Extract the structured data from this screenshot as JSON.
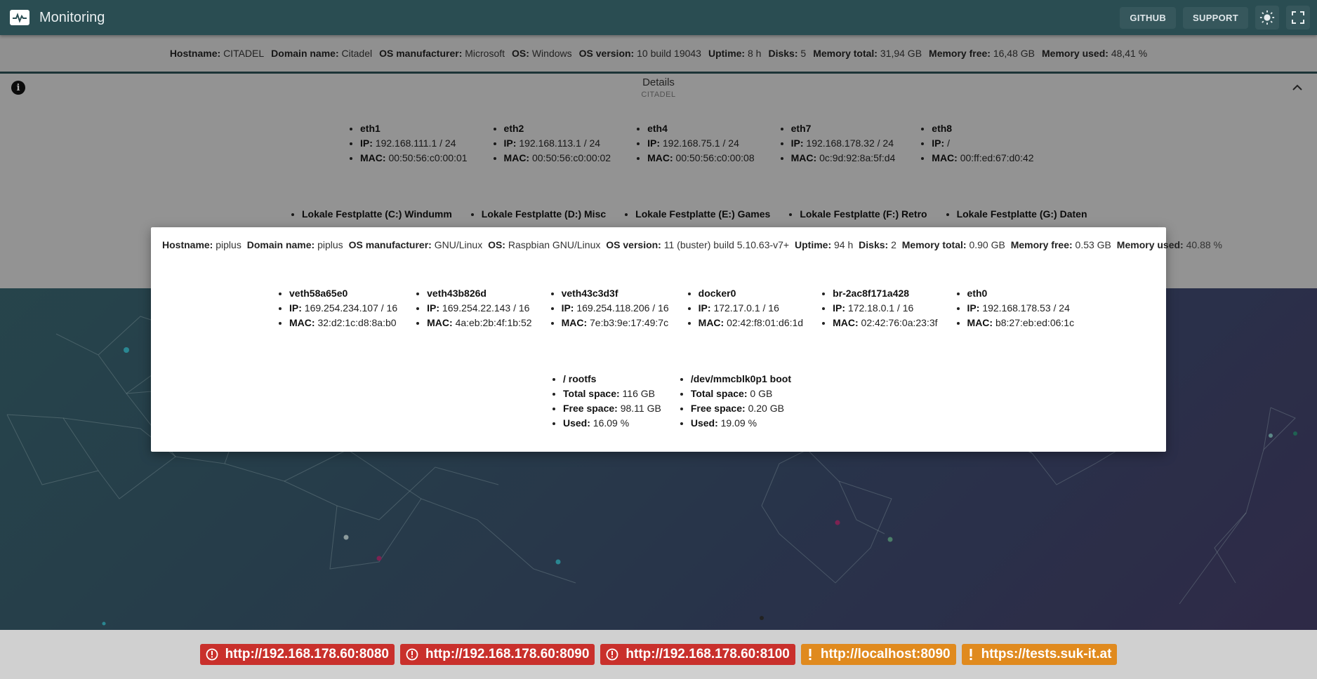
{
  "app": {
    "title": "Monitoring"
  },
  "toolbar": {
    "github_label": "GITHUB",
    "support_label": "SUPPORT"
  },
  "host_summary": [
    {
      "key": "Hostname:",
      "value": "CITADEL"
    },
    {
      "key": "Domain name:",
      "value": "Citadel"
    },
    {
      "key": "OS manufacturer:",
      "value": "Microsoft"
    },
    {
      "key": "OS:",
      "value": "Windows"
    },
    {
      "key": "OS version:",
      "value": "10 build 19043"
    },
    {
      "key": "Uptime:",
      "value": "8 h"
    },
    {
      "key": "Disks:",
      "value": "5"
    },
    {
      "key": "Memory total:",
      "value": "31,94 GB"
    },
    {
      "key": "Memory free:",
      "value": "16,48 GB"
    },
    {
      "key": "Memory used:",
      "value": "48,41 %"
    }
  ],
  "details": {
    "title": "Details",
    "subtitle": "CITADEL",
    "interfaces": [
      {
        "name": "eth1",
        "ip_label": "IP:",
        "ip": "192.168.111.1 / 24",
        "mac_label": "MAC:",
        "mac": "00:50:56:c0:00:01"
      },
      {
        "name": "eth2",
        "ip_label": "IP:",
        "ip": "192.168.113.1 / 24",
        "mac_label": "MAC:",
        "mac": "00:50:56:c0:00:02"
      },
      {
        "name": "eth4",
        "ip_label": "IP:",
        "ip": "192.168.75.1 / 24",
        "mac_label": "MAC:",
        "mac": "00:50:56:c0:00:08"
      },
      {
        "name": "eth7",
        "ip_label": "IP:",
        "ip": "192.168.178.32 / 24",
        "mac_label": "MAC:",
        "mac": "0c:9d:92:8a:5f:d4"
      },
      {
        "name": "eth8",
        "ip_label": "IP:",
        "ip": "/",
        "mac_label": "MAC:",
        "mac": "00:ff:ed:67:d0:42"
      }
    ],
    "disks": [
      {
        "name": "Lokale Festplatte (C:) Windumm"
      },
      {
        "name": "Lokale Festplatte (D:) Misc"
      },
      {
        "name": "Lokale Festplatte (E:) Games"
      },
      {
        "name": "Lokale Festplatte (F:) Retro"
      },
      {
        "name": "Lokale Festplatte (G:) Daten"
      }
    ]
  },
  "modal": {
    "summary": [
      {
        "key": "Hostname:",
        "value": "piplus"
      },
      {
        "key": "Domain name:",
        "value": "piplus"
      },
      {
        "key": "OS manufacturer:",
        "value": "GNU/Linux"
      },
      {
        "key": "OS:",
        "value": "Raspbian GNU/Linux"
      },
      {
        "key": "OS version:",
        "value": "11 (buster) build 5.10.63-v7+"
      },
      {
        "key": "Uptime:",
        "value": "94 h"
      },
      {
        "key": "Disks:",
        "value": "2"
      },
      {
        "key": "Memory total:",
        "value": "0.90 GB"
      },
      {
        "key": "Memory free:",
        "value": "0.53 GB"
      },
      {
        "key": "Memory used:",
        "value": "40.88 %"
      }
    ],
    "interfaces": [
      {
        "name": "veth58a65e0",
        "ip_label": "IP:",
        "ip": "169.254.234.107 / 16",
        "mac_label": "MAC:",
        "mac": "32:d2:1c:d8:8a:b0"
      },
      {
        "name": "veth43b826d",
        "ip_label": "IP:",
        "ip": "169.254.22.143 / 16",
        "mac_label": "MAC:",
        "mac": "4a:eb:2b:4f:1b:52"
      },
      {
        "name": "veth43c3d3f",
        "ip_label": "IP:",
        "ip": "169.254.118.206 / 16",
        "mac_label": "MAC:",
        "mac": "7e:b3:9e:17:49:7c"
      },
      {
        "name": "docker0",
        "ip_label": "IP:",
        "ip": "172.17.0.1 / 16",
        "mac_label": "MAC:",
        "mac": "02:42:f8:01:d6:1d"
      },
      {
        "name": "br-2ac8f171a428",
        "ip_label": "IP:",
        "ip": "172.18.0.1 / 16",
        "mac_label": "MAC:",
        "mac": "02:42:76:0a:23:3f"
      },
      {
        "name": "eth0",
        "ip_label": "IP:",
        "ip": "192.168.178.53 / 24",
        "mac_label": "MAC:",
        "mac": "b8:27:eb:ed:06:1c"
      }
    ],
    "disks": [
      {
        "name": "/ rootfs",
        "total_label": "Total space:",
        "total": "116 GB",
        "free_label": "Free space:",
        "free": "98.11 GB",
        "used_label": "Used:",
        "used": "16.09 %"
      },
      {
        "name": "/dev/mmcblk0p1 boot",
        "total_label": "Total space:",
        "total": "0 GB",
        "free_label": "Free space:",
        "free": "0.20 GB",
        "used_label": "Used:",
        "used": "19.09 %"
      }
    ]
  },
  "footer": {
    "urls": [
      {
        "label": "http://192.168.178.60:8080",
        "status": "error",
        "color": "#c9302c"
      },
      {
        "label": "http://192.168.178.60:8090",
        "status": "error",
        "color": "#c9302c"
      },
      {
        "label": "http://192.168.178.60:8100",
        "status": "error",
        "color": "#c9302c"
      },
      {
        "label": "http://localhost:8090",
        "status": "warning",
        "color": "#e08a1e"
      },
      {
        "label": "https://tests.suk-it.at",
        "status": "warning",
        "color": "#e08a1e"
      }
    ]
  },
  "colors": {
    "topbar": "#2a4d52",
    "error": "#c9302c",
    "warning": "#e08a1e"
  }
}
